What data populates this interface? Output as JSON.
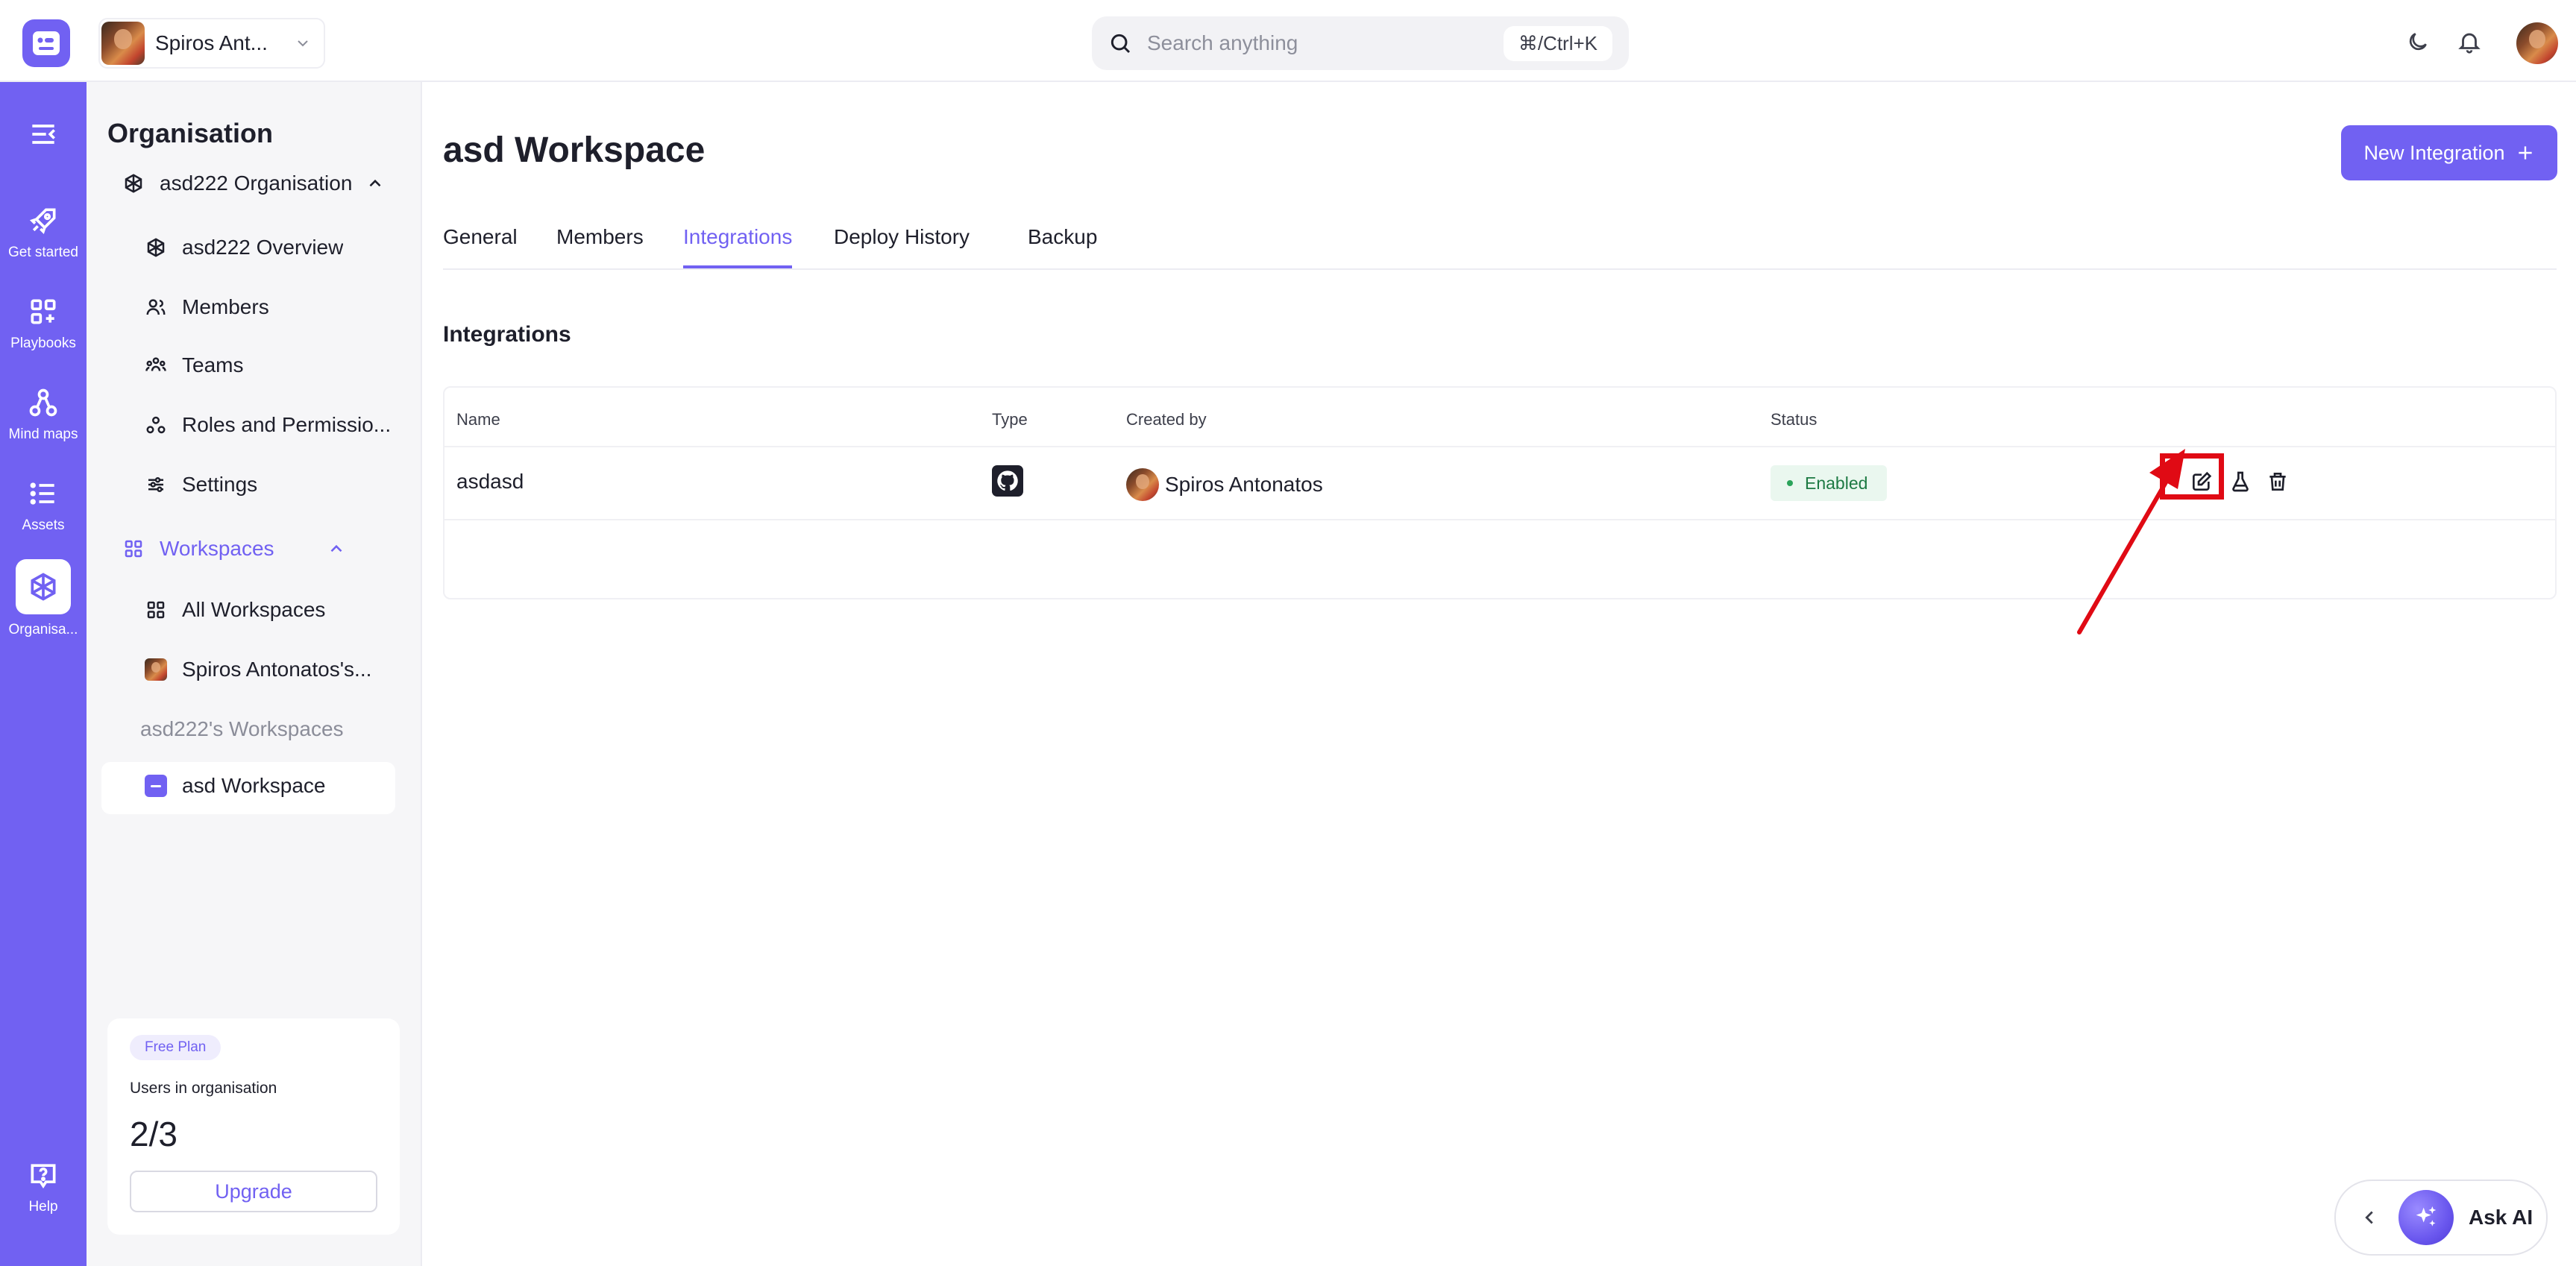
{
  "topbar": {
    "org_switcher_name": "Spiros Ant...",
    "search_placeholder": "Search anything",
    "search_shortcut": "⌘/Ctrl+K"
  },
  "rail": {
    "items": [
      {
        "label": "Get started",
        "icon": "rocket-icon"
      },
      {
        "label": "Playbooks",
        "icon": "grid-plus-icon"
      },
      {
        "label": "Mind maps",
        "icon": "mind-map-icon"
      },
      {
        "label": "Assets",
        "icon": "list-icon"
      },
      {
        "label": "Organisa...",
        "icon": "organisation-icon"
      },
      {
        "label": "Help",
        "icon": "help-icon"
      }
    ]
  },
  "sidebar": {
    "title": "Organisation",
    "org_name": "asd222 Organisation",
    "org_items": [
      {
        "label": "asd222 Overview"
      },
      {
        "label": "Members"
      },
      {
        "label": "Teams"
      },
      {
        "label": "Roles and Permissio..."
      },
      {
        "label": "Settings"
      }
    ],
    "workspaces_label": "Workspaces",
    "all_workspaces": "All Workspaces",
    "spiros_workspace": "Spiros Antonatos's...",
    "asd222_group": "asd222's Workspaces",
    "active_workspace": "asd Workspace"
  },
  "plan": {
    "badge": "Free Plan",
    "users_label": "Users in organisation",
    "users_count": "2/3",
    "upgrade_label": "Upgrade"
  },
  "main": {
    "title": "asd Workspace",
    "new_integration_label": "New Integration",
    "tabs": [
      {
        "label": "General"
      },
      {
        "label": "Members"
      },
      {
        "label": "Integrations"
      },
      {
        "label": "Deploy History"
      },
      {
        "label": "Backup"
      }
    ],
    "active_tab": "Integrations",
    "section_title": "Integrations",
    "table": {
      "columns": [
        "Name",
        "Type",
        "Created by",
        "Status"
      ],
      "rows": [
        {
          "name": "asdasd",
          "type_icon": "github-icon",
          "created_by": "Spiros Antonatos",
          "status": "Enabled"
        }
      ]
    }
  },
  "ask_ai": {
    "label": "Ask AI"
  },
  "colors": {
    "brand": "#7161f2",
    "status_enabled_bg": "#eaf7ef",
    "status_enabled_text": "#1d7a43",
    "annotation_red": "#e00a14"
  }
}
